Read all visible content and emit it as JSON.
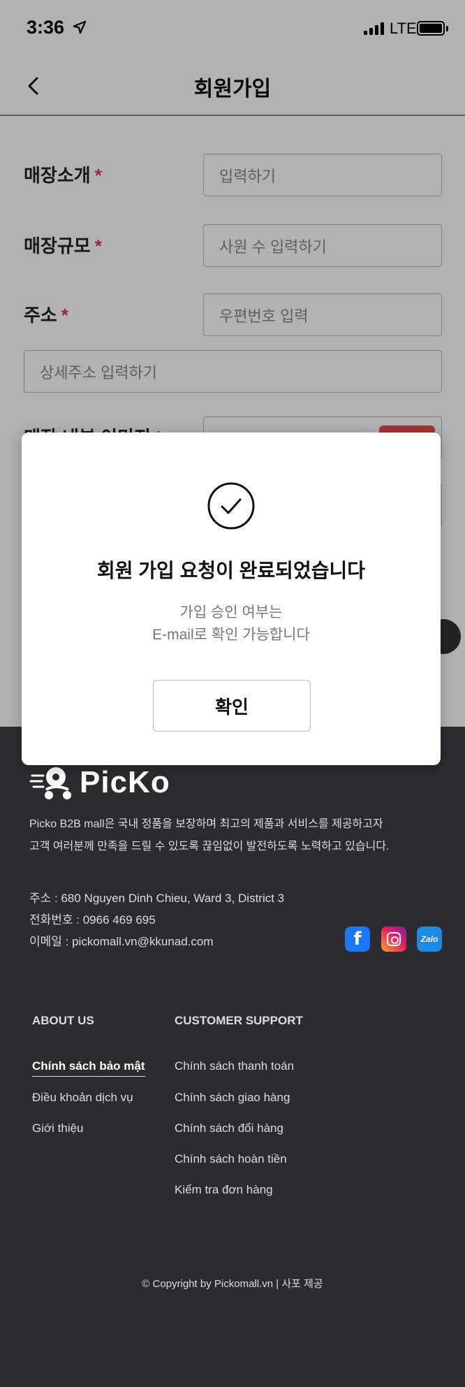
{
  "status_bar": {
    "time": "3:36",
    "network": "LTE"
  },
  "header": {
    "title": "회원가입"
  },
  "form": {
    "intro_label": "매장소개",
    "intro_placeholder": "입력하기",
    "size_label": "매장규모",
    "size_placeholder": "사원 수 입력하기",
    "address_label": "주소",
    "zip_placeholder": "우편번호 입력",
    "detail_placeholder": "상세주소 입력하기",
    "image_label": "매장 내부 이미지",
    "required_mark": "*"
  },
  "modal": {
    "title": "회원 가입 요청이 완료되었습니다",
    "subtitle_line1": "가입 승인 여부는",
    "subtitle_line2": "E-mail로 확인 가능합니다",
    "confirm_label": "확인"
  },
  "footer": {
    "logo_text": "PicKo",
    "desc_line1": "Picko B2B mall은 국내 정품을 보장하며 최고의 제품과 서비스를 제공하고자",
    "desc_line2": "고객 여러분께 만족을 드릴 수 있도록 끊임없이 발전하도록 노력하고 있습니다.",
    "address": "주소 : 680 Nguyen Dinh Chieu, Ward 3, District 3",
    "phone": "전화번호 : 0966 469 695",
    "email": "이메일 : pickomall.vn@kkunad.com",
    "social": {
      "zalo_text": "Zalo",
      "fb_text": "f"
    },
    "about_title": "ABOUT US",
    "about_items": [
      "Chính sách bảo mật",
      "Điều khoản dịch vụ",
      "Giới thiệu"
    ],
    "support_title": "CUSTOMER SUPPORT",
    "support_items": [
      "Chính sách thanh toán",
      "Chính sách giao hàng",
      "Chính sách đổi hàng",
      "Chính sách hoàn tiền",
      "Kiểm tra đơn hàng"
    ],
    "copyright": "© Copyright by Pickomall.vn | 사포 제공"
  },
  "colors": {
    "required": "#e23b3b",
    "footer_bg": "#2b2b30",
    "accent_red": "#e84b4b"
  }
}
